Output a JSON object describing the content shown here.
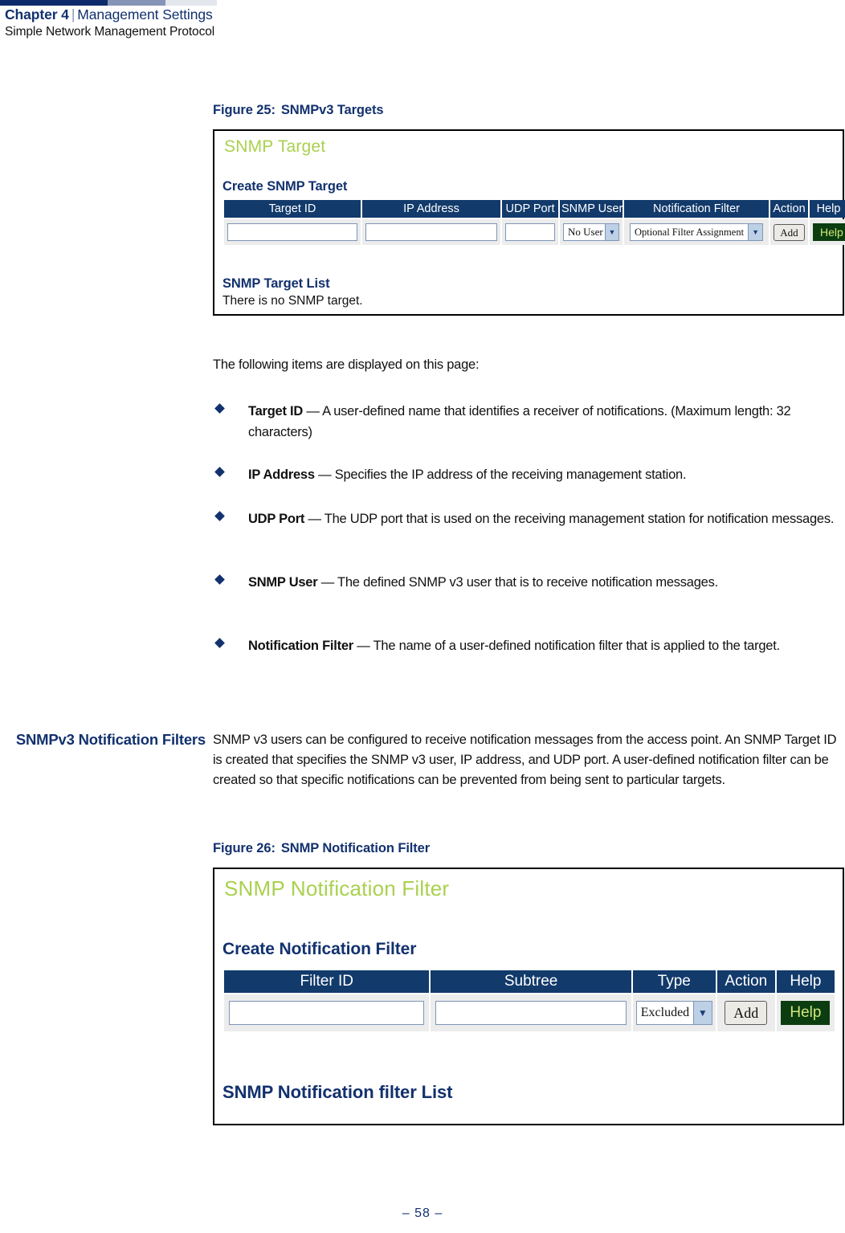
{
  "header": {
    "chapter": "Chapter 4",
    "separator": "|",
    "section": "Management Settings",
    "subsection": "Simple Network Management Protocol"
  },
  "colors": {
    "navy": "#12316e",
    "table_header_bg": "#123a6b",
    "ui_title_green": "#a9d14e",
    "help_button_bg": "#0c3d10",
    "help_button_text": "#cfe77a",
    "bullet_diamond": "#12316e"
  },
  "figure25": {
    "caption_label": "Figure 25:",
    "caption_title": "SNMPv3 Targets",
    "ui": {
      "page_title": "SNMP Target",
      "create_heading": "Create SNMP Target",
      "columns": [
        "Target ID",
        "IP Address",
        "UDP Port",
        "SNMP User",
        "Notification Filter",
        "Action",
        "Help"
      ],
      "row": {
        "target_id_value": "",
        "target_id_placeholder": "",
        "ip_address_value": "",
        "ip_address_placeholder": "",
        "udp_port_value": "",
        "udp_port_placeholder": "",
        "snmp_user_selected": "No User",
        "notification_filter_selected": "Optional Filter Assignment",
        "add_label": "Add",
        "help_label": "Help"
      },
      "list_heading": "SNMP Target List",
      "list_empty_text": "There is no SNMP target."
    }
  },
  "intro": {
    "lead": "The following items are displayed on this page:",
    "bullets": [
      {
        "term": "Target ID",
        "dash": "—",
        "desc": "A user-defined name that identifies a receiver of notifications. (Maximum length: 32 characters)"
      },
      {
        "term": "IP Address",
        "dash": "—",
        "desc": "Specifies the IP address of the receiving management station."
      },
      {
        "term": "UDP Port",
        "dash": "—",
        "desc": "The UDP port that is used on the receiving management station for notification messages."
      },
      {
        "term": "SNMP User",
        "dash": "—",
        "desc": "The defined SNMP v3 user that is to receive notification messages."
      },
      {
        "term": "Notification Filter",
        "dash": "—",
        "desc": "The name of a user-defined notification filter that is applied to the target."
      }
    ]
  },
  "section_filters": {
    "margin_heading": "SNMPv3 Notification Filters",
    "paragraph": "SNMP v3 users can be configured to receive notification messages from the access point. An SNMP Target ID is created that specifies the SNMP v3 user, IP address, and UDP port. A user-defined notification filter can be created so that specific notifications can be prevented from being sent to particular targets."
  },
  "figure26": {
    "caption_label": "Figure 26:",
    "caption_title": "SNMP Notification Filter",
    "ui": {
      "page_title": "SNMP Notification Filter",
      "create_heading": "Create Notification Filter",
      "columns": [
        "Filter ID",
        "Subtree",
        "Type",
        "Action",
        "Help"
      ],
      "row": {
        "filter_id_value": "",
        "filter_id_placeholder": "",
        "subtree_value": "",
        "subtree_placeholder": "",
        "type_selected": "Excluded",
        "add_label": "Add",
        "help_label": "Help"
      },
      "list_heading": "SNMP Notification filter List"
    }
  },
  "footer": {
    "page_number": "–  58  –"
  }
}
